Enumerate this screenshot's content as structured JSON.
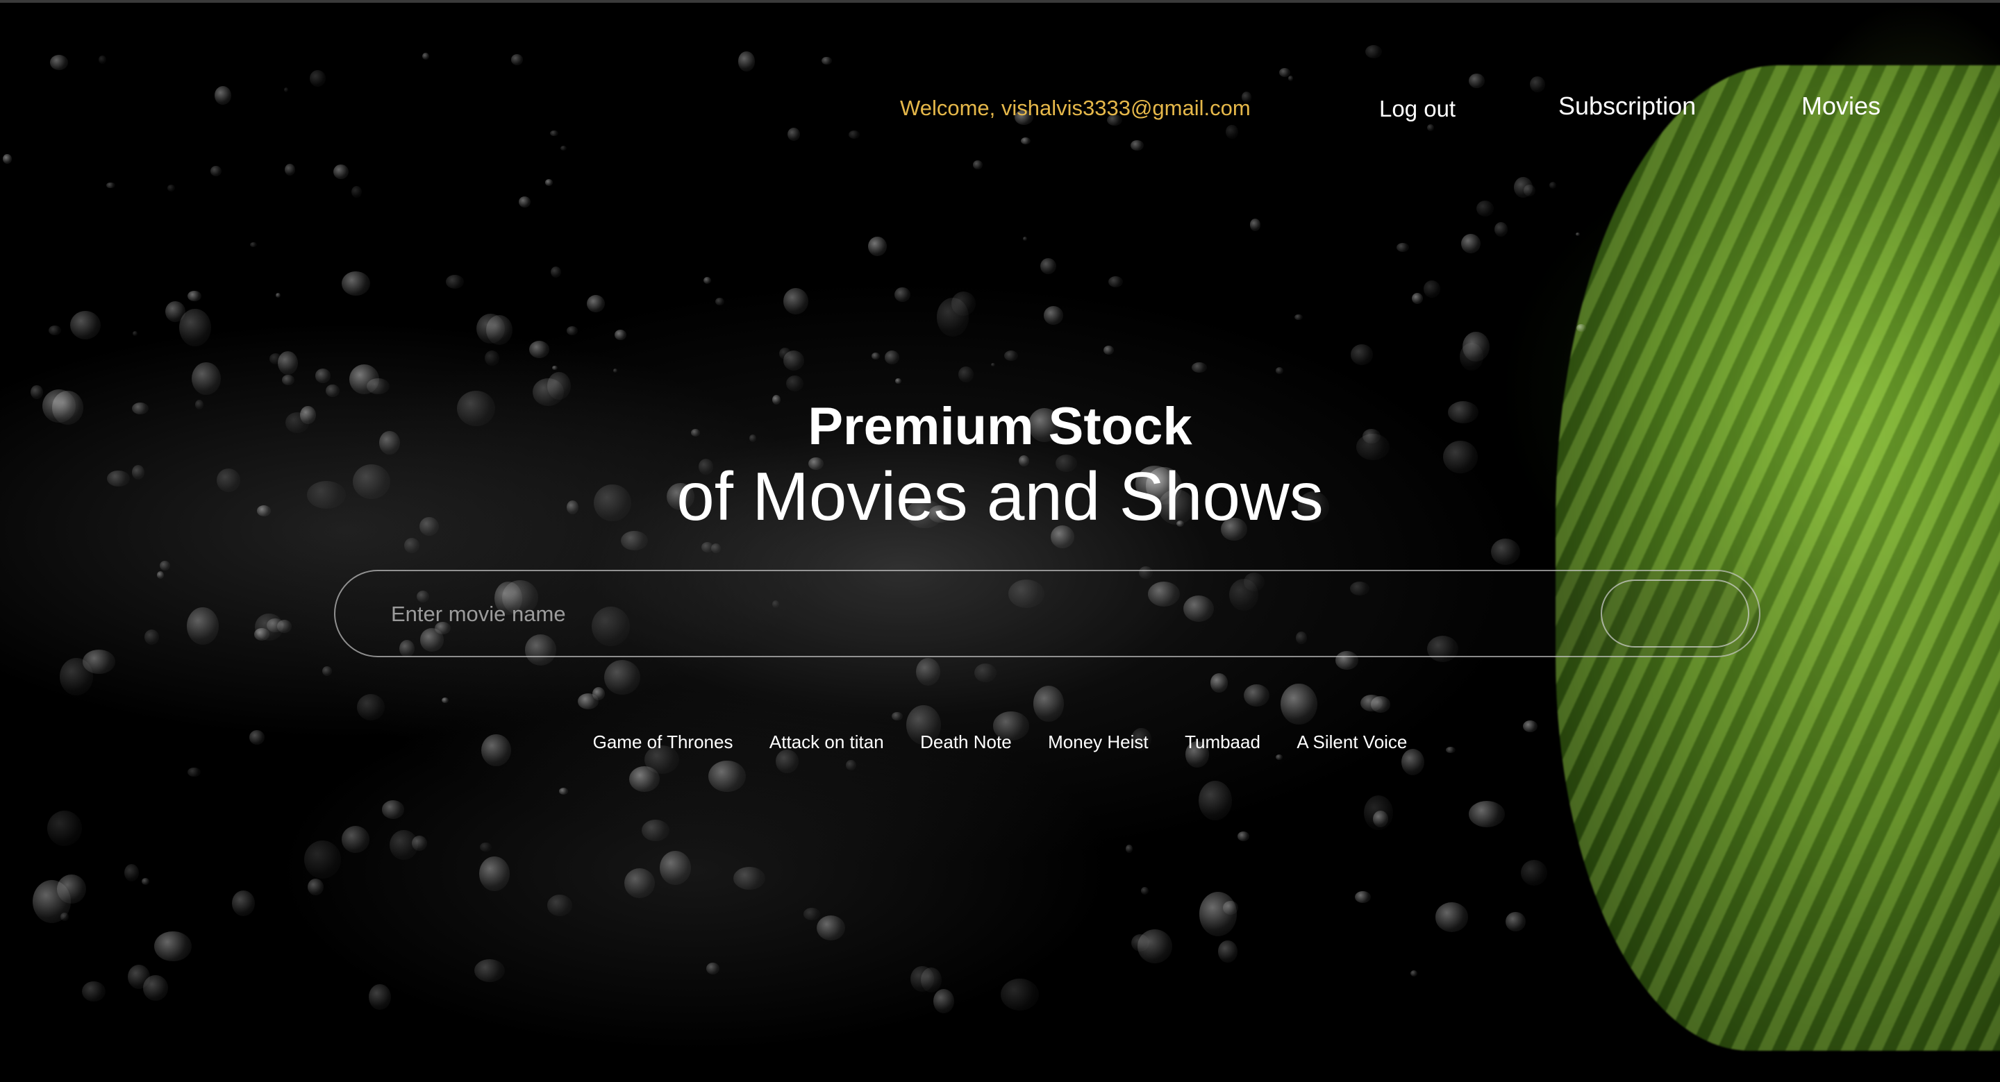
{
  "nav": {
    "welcome_text": "Welcome, vishalvis3333@gmail.com",
    "logout_label": "Log out",
    "subscription_label": "Subscription",
    "movies_label": "Movies"
  },
  "hero": {
    "title": "Premium Stock",
    "subtitle": "of Movies and Shows"
  },
  "search": {
    "placeholder": "Enter movie name",
    "value": "",
    "button_label": ""
  },
  "suggestions": [
    {
      "label": "Game of Thrones"
    },
    {
      "label": "Attack on titan"
    },
    {
      "label": "Death Note"
    },
    {
      "label": "Money Heist"
    },
    {
      "label": "Tumbaad"
    },
    {
      "label": "A Silent Voice"
    }
  ],
  "colors": {
    "welcome_accent": "#e6b84a",
    "text": "#ffffff",
    "background": "#000000"
  }
}
